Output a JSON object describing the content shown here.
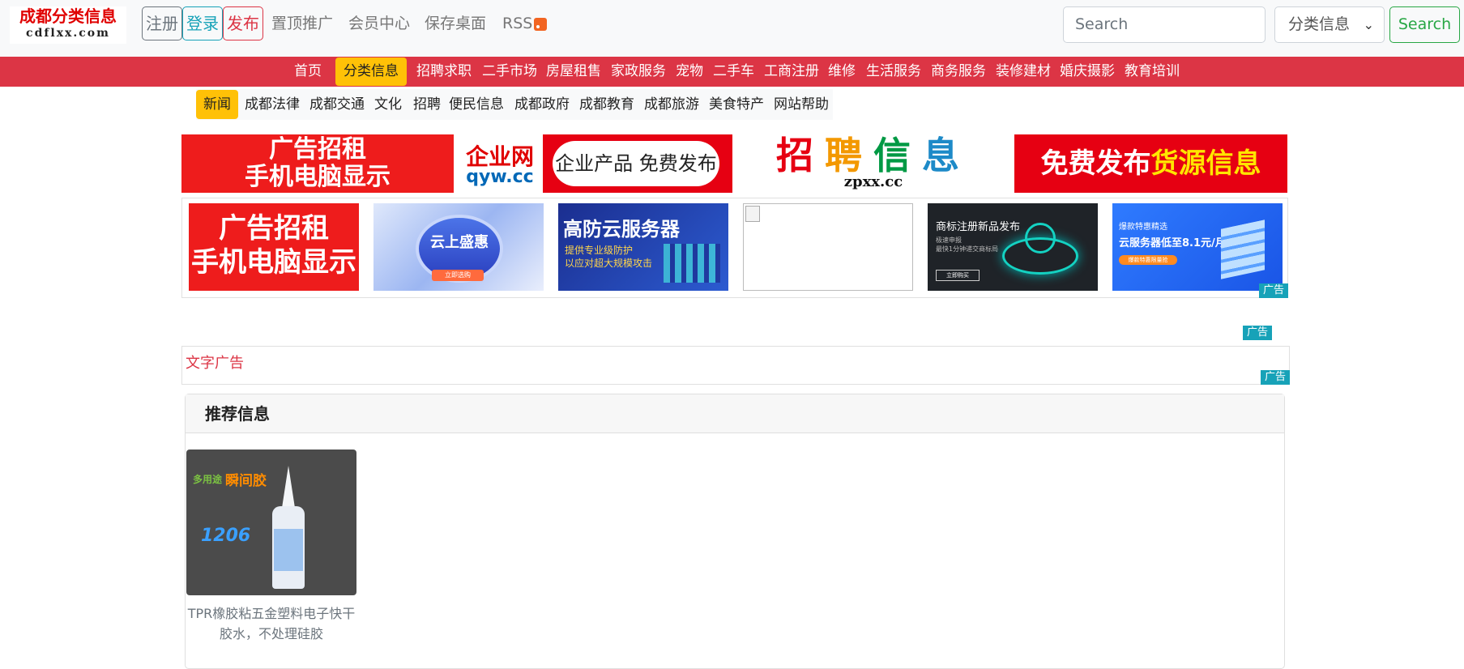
{
  "logo": {
    "line1": "成都分类信息",
    "line2": "cdflxx.com"
  },
  "header": {
    "register_label": "注册",
    "login_label": "登录",
    "post_label": "发布",
    "links": [
      "置顶推广",
      "会员中心",
      "保存桌面"
    ],
    "rss_label": "RSS"
  },
  "search": {
    "placeholder": "Search",
    "select_value": "分类信息",
    "button_label": "Search"
  },
  "main_nav": {
    "items": [
      "首页",
      "分类信息",
      "招聘求职",
      "二手市场",
      "房屋租售",
      "家政服务",
      "宠物",
      "二手车",
      "工商注册",
      "维修",
      "生活服务",
      "商务服务",
      "装修建材",
      "婚庆摄影",
      "教育培训"
    ],
    "active": "分类信息"
  },
  "sub_nav": {
    "items": [
      "新闻",
      "成都法律",
      "成都交通",
      "文化",
      "招聘",
      "便民信息",
      "成都政府",
      "成都教育",
      "成都旅游",
      "美食特产",
      "网站帮助"
    ],
    "active": "新闻"
  },
  "banners": {
    "ad1": {
      "line1": "广告招租",
      "line2": "手机电脑显示"
    },
    "ad2": {
      "brand": "企业网",
      "url": "qyw.cc",
      "slogan": "企业产品 免费发布"
    },
    "ad3": {
      "title": "招聘信息",
      "url": "zpxx.cc"
    },
    "ad4": {
      "prefix": "免费发布",
      "highlight": "货源信息"
    }
  },
  "tiles": {
    "t1": {
      "line1": "广告招租",
      "line2": "手机电脑显示"
    },
    "t2": {
      "title": "云上盛惠",
      "button": "立即选购"
    },
    "t3": {
      "title": "高防云服务器",
      "sub1": "提供专业级防护",
      "sub2": "以应对超大规模攻击"
    },
    "t5": {
      "title": "商标注册新品发布",
      "sub1": "极速申报",
      "sub2": "最快1分钟递交商标局",
      "button": "立即购买"
    },
    "t6": {
      "small": "爆款特惠精选",
      "title": "云服务器低至8.1元/月",
      "button": "爆款特惠限量抢"
    }
  },
  "ad_tag_label": "广告",
  "text_ad": {
    "text": "文字广告"
  },
  "recommend": {
    "title": "推荐信息",
    "items": [
      {
        "title": "TPR橡胶粘五金塑料电子快干胶水，不处理硅胶",
        "img_text1": "多用途",
        "img_text2": "瞬间胶",
        "img_code": "1206"
      }
    ]
  },
  "colors": {
    "brand_red": "#dc3545",
    "active_yellow": "#ffc107",
    "search_green": "#28a745",
    "ad_tag": "#17a2b8"
  }
}
